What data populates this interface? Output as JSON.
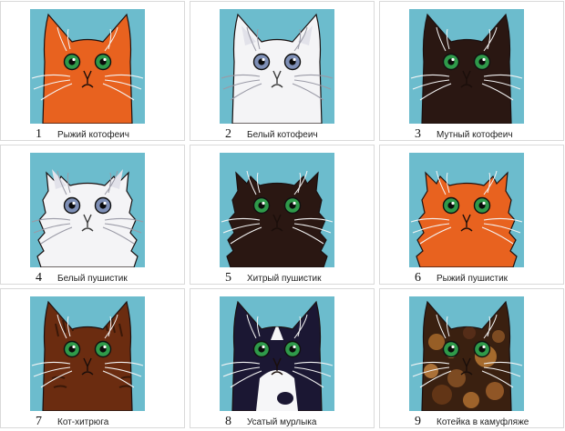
{
  "colors": {
    "background": "#6cbccd",
    "ginger": "#e8621f",
    "white": "#f4f4f6",
    "dark": "#2a1712",
    "tabby": "#6b2c10"
  },
  "cats": [
    {
      "number": "1",
      "name": "Рыжий котофеич",
      "fur": "ginger",
      "eyes": "green",
      "fluffy": false
    },
    {
      "number": "2",
      "name": "Белый котофеич",
      "fur": "white",
      "eyes": "blue",
      "fluffy": false
    },
    {
      "number": "3",
      "name": "Мутный котофеич",
      "fur": "dark",
      "eyes": "green",
      "fluffy": false
    },
    {
      "number": "4",
      "name": "Белый пушистик",
      "fur": "white",
      "eyes": "blue",
      "fluffy": true
    },
    {
      "number": "5",
      "name": "Хитрый пушистик",
      "fur": "dark",
      "eyes": "green",
      "fluffy": true
    },
    {
      "number": "6",
      "name": "Рыжий пушистик",
      "fur": "ginger",
      "eyes": "green",
      "fluffy": true
    },
    {
      "number": "7",
      "name": "Кот-хитрюга",
      "fur": "tabby",
      "eyes": "green",
      "fluffy": false
    },
    {
      "number": "8",
      "name": "Усатый мурлыка",
      "fur": "tuxedo",
      "eyes": "green",
      "fluffy": false
    },
    {
      "number": "9",
      "name": "Котейка в камуфляже",
      "fur": "tortoiseshell",
      "eyes": "green",
      "fluffy": false
    }
  ]
}
